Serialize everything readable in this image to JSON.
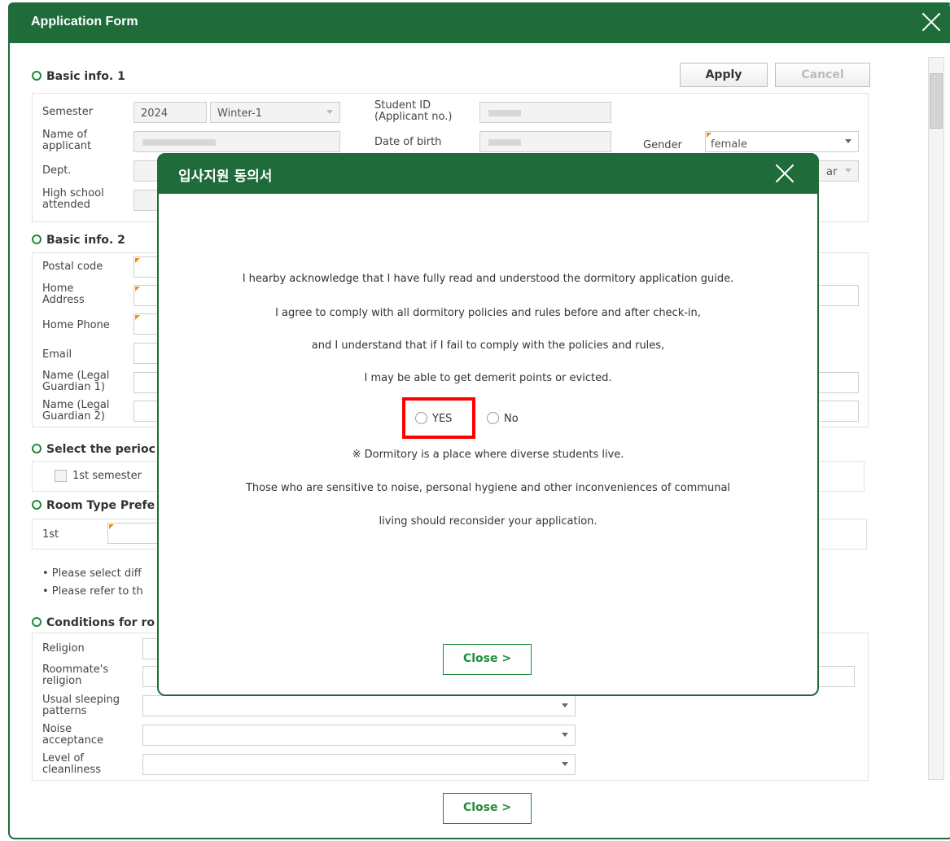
{
  "window": {
    "title": "Application Form"
  },
  "toolbar": {
    "apply": "Apply",
    "cancel": "Cancel"
  },
  "basic1": {
    "heading": "Basic info. 1",
    "semester_label": "Semester",
    "semester_year": "2024",
    "semester_term": "Winter-1",
    "student_id_label": "Student ID\n(Applicant no.)",
    "name_label": "Name of\napplicant",
    "dob_label": "Date of birth",
    "gender_label": "Gender",
    "gender_value": "female",
    "dept_label": "Dept.",
    "year_value_partial": "ar",
    "highschool_label": "High school\nattended"
  },
  "basic2": {
    "heading": "Basic info. 2",
    "postal_label": "Postal code",
    "home_address_label": "Home\nAddress",
    "home_phone_label": "Home Phone",
    "email_label": "Email",
    "guardian1_label": "Name (Legal\nGuardian 1)",
    "guardian2_label": "Name (Legal\nGuardian 2)"
  },
  "period": {
    "heading": "Select the perioc",
    "option1": "1st semester"
  },
  "room": {
    "heading": "Room Type Prefe",
    "rank1": "1st"
  },
  "notes": [
    "• Please select diff",
    "• Please refer to th"
  ],
  "conditions": {
    "heading": "Conditions for ro",
    "religion_label": "Religion",
    "roommate_religion_label": "Roommate's\nreligion",
    "sleeping_label": "Usual sleeping\npatterns",
    "noise_label": "Noise\nacceptance",
    "cleanliness_label": "Level of\ncleanliness"
  },
  "footer": {
    "close": "Close  >"
  },
  "modal": {
    "title": "입사지원 동의서",
    "lines": [
      "I hearby acknowledge that I have fully read and understood the dormitory application guide.",
      "I agree to comply with all dormitory policies and rules before and after check-in,",
      "and I understand that if I fail to comply with the policies and rules,",
      "I may be able to get demerit points or evicted."
    ],
    "yes": "YES",
    "no": "No",
    "notice_lines": [
      "※ Dormitory is a place where diverse students live.",
      "Those who are sensitive to noise, personal hygiene and other inconveniences of communal",
      "living should reconsider your application."
    ],
    "close": "Close  >"
  },
  "colors": {
    "brand": "#1f6b3a",
    "accent": "#1f8b3a",
    "highlight": "#ff0000",
    "required_marker": "#ff8a00"
  }
}
